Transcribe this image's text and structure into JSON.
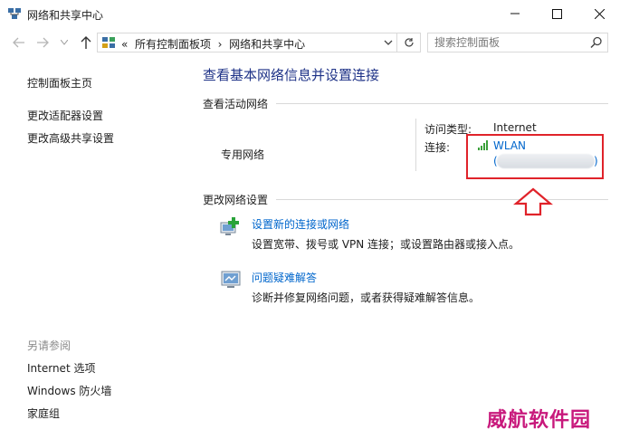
{
  "window": {
    "title": "网络和共享中心",
    "icon": "network-center-icon"
  },
  "addressbar": {
    "prefix": "«",
    "crumb1": "所有控制面板项",
    "separator": "›",
    "crumb2": "网络和共享中心"
  },
  "search": {
    "placeholder": "搜索控制面板"
  },
  "sidebar": {
    "home": "控制面板主页",
    "adapter": "更改适配器设置",
    "advanced_sharing": "更改高级共享设置",
    "see_also": "另请参阅",
    "internet_options": "Internet 选项",
    "firewall": "Windows 防火墙",
    "homegroup": "家庭组"
  },
  "main": {
    "title": "查看基本网络信息并设置连接",
    "active_header": "查看活动网络",
    "network_name": "专用网络",
    "access_type_label": "访问类型:",
    "access_type_value": "Internet",
    "connection_label": "连接:",
    "connection_value": "WLAN",
    "connection_paren_open": "(",
    "connection_paren_close": ")",
    "change_header": "更改网络设置",
    "tasks": [
      {
        "title": "设置新的连接或网络",
        "desc": "设置宽带、拨号或 VPN 连接；或设置路由器或接入点。"
      },
      {
        "title": "问题疑难解答",
        "desc": "诊断并修复网络问题，或者获得疑难解答信息。"
      }
    ]
  },
  "annotation": {
    "highlight_color": "#e0232a",
    "watermark": "威航软件园",
    "watermark_color": "#c8197c"
  },
  "colors": {
    "link": "#0066cc",
    "title": "#1e3287",
    "separator": "#d9d9d9"
  }
}
